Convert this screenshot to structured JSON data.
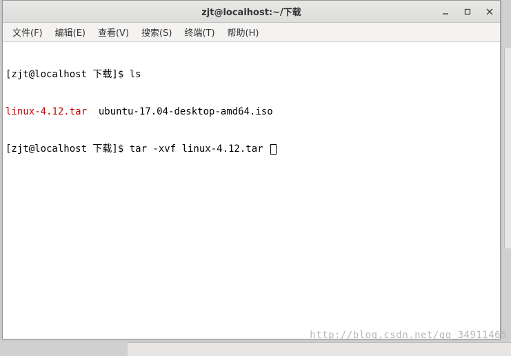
{
  "titlebar": {
    "title": "zjt@localhost:~/下载"
  },
  "menubar": {
    "file": "文件(F)",
    "edit": "编辑(E)",
    "view": "查看(V)",
    "search": "搜索(S)",
    "terminal": "终端(T)",
    "help": "帮助(H)"
  },
  "terminal": {
    "line1_prompt": "[zjt@localhost 下载]$ ",
    "line1_cmd": "ls",
    "line2_file1": "linux-4.12.tar",
    "line2_spacer": "  ",
    "line2_file2": "ubuntu-17.04-desktop-amd64.iso",
    "line3_prompt": "[zjt@localhost 下载]$ ",
    "line3_cmd": "tar -xvf linux-4.12.tar "
  },
  "watermark": "http://blog.csdn.net/qq_34911465"
}
